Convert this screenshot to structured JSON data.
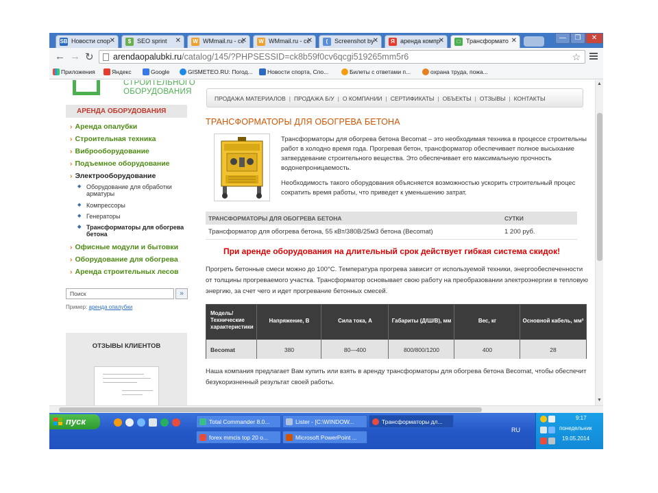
{
  "browser": {
    "tabs": [
      {
        "label": "Новости спор",
        "favicon": "sb-icon",
        "active": false
      },
      {
        "label": "SEO sprint",
        "favicon": "seo-sprint-icon",
        "active": false
      },
      {
        "label": "WMmail.ru - сє",
        "favicon": "wmmail-icon",
        "active": false
      },
      {
        "label": "WMmail.ru - сє",
        "favicon": "wmmail-icon",
        "active": false
      },
      {
        "label": "Screenshot by",
        "favicon": "screenshot-icon",
        "active": false
      },
      {
        "label": "аренда компр",
        "favicon": "yandex-icon",
        "active": false
      },
      {
        "label": "Трансформато",
        "favicon": "site-icon",
        "active": true
      }
    ],
    "url_host": "arendaopalubki.ru",
    "url_path": "/catalog/145/?PHPSESSID=ck8b59f0cv6qcgi519265mm5r6",
    "bookmarks": [
      {
        "label": "Приложения",
        "icon": "apps-icon"
      },
      {
        "label": "Яндекс",
        "icon": "yandex-icon"
      },
      {
        "label": "Google",
        "icon": "google-icon"
      },
      {
        "label": "GISMETEO.RU: Погод...",
        "icon": "gismeteo-icon"
      },
      {
        "label": "Новости спорта, Спо...",
        "icon": "sb-icon"
      },
      {
        "label": "Билеты с ответами п...",
        "icon": "tickets-icon"
      },
      {
        "label": "охрана труда, пожа...",
        "icon": "safety-icon"
      }
    ]
  },
  "logo": {
    "line1": "СТРОИТЕЛЬНОГО",
    "line2": "ОБОРУДОВАНИЯ"
  },
  "sidebar": {
    "heading": "АРЕНДА ОБОРУДОВАНИЯ",
    "items": [
      "Аренда опалубки",
      "Строительная техника",
      "Виброоборудование",
      "Подъемное оборудование",
      "Электрооборудование"
    ],
    "subitems": [
      "Оборудование для обработки арматуры",
      "Компрессоры",
      "Генераторы",
      "Трансформаторы для обогрева бетона"
    ],
    "items_after": [
      "Офисные модули и бытовки",
      "Оборудование для обогрева",
      "Аренда строительных лесов"
    ],
    "search_placeholder": "Поиск",
    "search_button": "»",
    "search_example_label": "Пример:",
    "search_example_link": "аренда опалубки",
    "reviews_title": "ОТЗЫВЫ КЛИЕНТОВ"
  },
  "topnav": [
    "ПРОДАЖА МАТЕРИАЛОВ",
    "ПРОДАЖА Б/У",
    "О КОМПАНИИ",
    "СЕРТИФИКАТЫ",
    "ОБЪЕКТЫ",
    "ОТЗЫВЫ",
    "КОНТАКТЫ"
  ],
  "main": {
    "title": "ТРАНСФОРМАТОРЫ ДЛЯ ОБОГРЕВА БЕТОНА",
    "intro_lines": [
      "Трансформаторы для обогрева бетона Becomat – это необходимая техника в процессе строительны",
      "работ в холодно время года. Прогревая бетон, трансформатор обеспечивает полное высыхание",
      "затвердевание строительного вещества. Это обеспечивает его максимальную прочность",
      "водонепроницаемость."
    ],
    "need_lines": [
      "Необходимость такого оборудования объясняется возможностью ускорить строительный процес",
      "сократить время работы, что приведет к уменьшению затрат."
    ],
    "price_table": {
      "headers": [
        "ТРАНСФОРМАТОРЫ ДЛЯ ОБОГРЕВА БЕТОНА",
        "СУТКИ"
      ],
      "rows": [
        [
          "Трансформатор для обогрева бетона, 55 кВт/380В/25м3 бетона (Becomat)",
          "1 200 руб."
        ]
      ]
    },
    "discount": "При аренде оборудования на длительный срок действует гибкая система скидок!",
    "heat_lines": [
      "Прогреть бетонные смеси можно до 100°С. Температура прогрева зависит от используемой техники, энергообеспеченности",
      "от толщины прогреваемого участка. Трансформатор основывает свою работу на преобразовании электроэнергии в тепловую",
      "энергию, за счет чего и идет прогревание бетонных смесей."
    ],
    "spec_table": {
      "headers": [
        "Модель/ Технические характеристики",
        "Напряжение, В",
        "Сила тока, А",
        "Габариты (Д/Ш/В), мм",
        "Вес, кг",
        "Основной кабель, мм²"
      ],
      "row": [
        "Becomat",
        "380",
        "80—400",
        "800/800/1200",
        "400",
        "28"
      ]
    },
    "offer_lines": [
      "Наша компания предлагает Вам купить или взять в аренду трансформаторы для обогрева бетона Becomat, чтобы обеспечит",
      "безукоризненный результат своей работы."
    ]
  },
  "taskbar": {
    "start_label": "пуск",
    "tasks": [
      {
        "label": "Total Commander 8.0...",
        "icon": "total-commander-icon",
        "active": false
      },
      {
        "label": "Lister - [C:\\WINDOW...",
        "icon": "lister-icon",
        "active": false
      },
      {
        "label": "Трансформаторы дл...",
        "icon": "chrome-icon",
        "active": true
      },
      {
        "label": "forex mmcis top 20 o...",
        "icon": "yandex-browser-icon",
        "active": false
      },
      {
        "label": "Microsoft PowerPoint ...",
        "icon": "powerpoint-icon",
        "active": false
      }
    ],
    "lang": "RU",
    "time": "9:17",
    "day": "понедельник",
    "date": "19.05.2014"
  }
}
